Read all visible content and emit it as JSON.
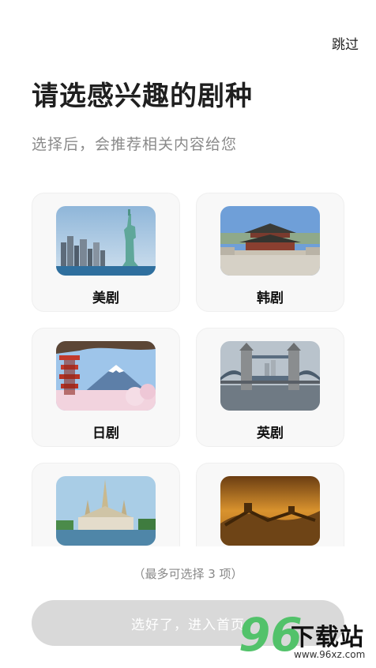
{
  "header": {
    "skip_label": "跳过",
    "title": "请选感兴趣的剧种",
    "subtitle": "选择后，会推荐相关内容给您"
  },
  "genres": [
    {
      "label": "美剧",
      "image": "statue-of-liberty"
    },
    {
      "label": "韩剧",
      "image": "korean-palace"
    },
    {
      "label": "日剧",
      "image": "mount-fuji-pagoda"
    },
    {
      "label": "英剧",
      "image": "tower-bridge"
    },
    {
      "label": "",
      "image": "thai-temple"
    },
    {
      "label": "",
      "image": "great-wall"
    }
  ],
  "footer": {
    "hint": "（最多可选择 3 项）",
    "confirm_label": "选好了，进入首页",
    "confirm_color": "#d9d9d9"
  },
  "watermark": {
    "number": "96",
    "text": "下载站",
    "url": "www.96xz.com"
  }
}
